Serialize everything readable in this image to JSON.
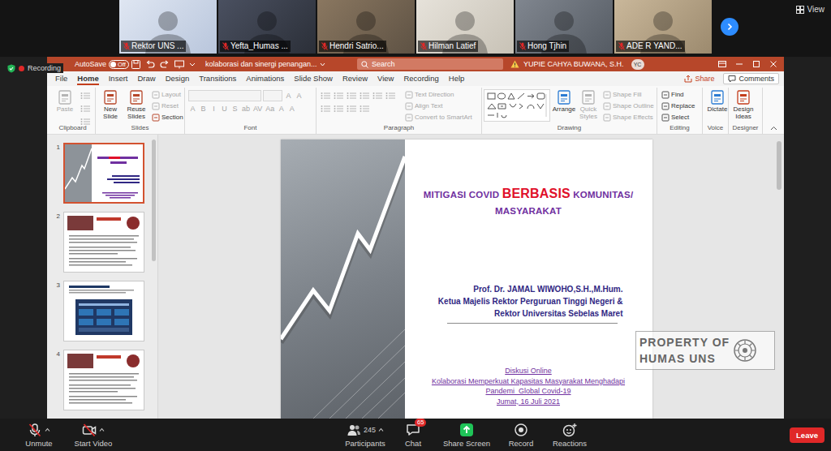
{
  "meeting": {
    "view_button": "View",
    "recording": "Recording",
    "participants": [
      {
        "name": "Rektor UNS ...",
        "muted": true
      },
      {
        "name": "Yefta_Humas ...",
        "muted": true
      },
      {
        "name": "Hendri Satrio...",
        "muted": true
      },
      {
        "name": "Hilman Latief",
        "muted": true
      },
      {
        "name": "Hong Tjhin",
        "muted": true
      },
      {
        "name": "ADE R YAND...",
        "muted": true
      }
    ],
    "toolbar": [
      {
        "label": "Unmute",
        "kind": "mic",
        "slashed": true,
        "has_menu": true
      },
      {
        "label": "Start Video",
        "kind": "video",
        "slashed": true,
        "has_menu": true
      },
      {
        "label": "Participants",
        "kind": "participants",
        "count": "245",
        "slashed": false,
        "has_menu": true
      },
      {
        "label": "Chat",
        "kind": "chat",
        "badge": "65",
        "slashed": false,
        "has_menu": false
      },
      {
        "label": "Share Screen",
        "kind": "share",
        "slashed": false,
        "has_menu": false
      },
      {
        "label": "Record",
        "kind": "record",
        "slashed": false,
        "has_menu": false
      },
      {
        "label": "Reactions",
        "kind": "reactions",
        "slashed": false,
        "has_menu": false
      }
    ],
    "leave": "Leave"
  },
  "app": {
    "title_bar": {
      "autosave_label": "AutoSave",
      "autosave_on": false,
      "autosave_state": "Off",
      "document": "kolaborasi dan sinergi penangan...",
      "search_placeholder": "Search",
      "user": "YUPIE CAHYA BUWANA, S.H.",
      "initials": "YC"
    },
    "menu": [
      {
        "label": "File",
        "selected": false
      },
      {
        "label": "Home",
        "selected": true
      },
      {
        "label": "Insert",
        "selected": false
      },
      {
        "label": "Draw",
        "selected": false
      },
      {
        "label": "Design",
        "selected": false
      },
      {
        "label": "Transitions",
        "selected": false
      },
      {
        "label": "Animations",
        "selected": false
      },
      {
        "label": "Slide Show",
        "selected": false
      },
      {
        "label": "Review",
        "selected": false
      },
      {
        "label": "View",
        "selected": false
      },
      {
        "label": "Recording",
        "selected": false
      },
      {
        "label": "Help",
        "selected": false
      }
    ],
    "share": "Share",
    "comments": "Comments",
    "ribbon": [
      {
        "label": "Clipboard",
        "items": [
          {
            "label": "Paste",
            "kind": "big",
            "disabled": true
          },
          {
            "kind": "icon",
            "disabled": true
          },
          {
            "kind": "icon",
            "disabled": true
          },
          {
            "kind": "icon",
            "disabled": true
          }
        ]
      },
      {
        "label": "Slides",
        "items": [
          {
            "label": "New Slide",
            "kind": "big",
            "disabled": false
          },
          {
            "label": "Reuse Slides",
            "kind": "big",
            "disabled": false
          },
          {
            "label": "Layout",
            "kind": "small",
            "disabled": true
          },
          {
            "label": "Reset",
            "kind": "small",
            "disabled": true
          },
          {
            "label": "Section",
            "kind": "small",
            "disabled": false
          }
        ]
      },
      {
        "label": "Font",
        "items": [
          {
            "kind": "field",
            "disabled": true
          },
          {
            "kind": "field",
            "disabled": true
          },
          {
            "label": "A",
            "kind": "glyph",
            "disabled": true
          },
          {
            "label": "A",
            "kind": "glyph",
            "disabled": true
          },
          {
            "label": "A",
            "kind": "glyph",
            "disabled": true
          },
          {
            "label": "B",
            "kind": "glyph",
            "disabled": true
          },
          {
            "label": "I",
            "kind": "glyph",
            "disabled": true
          },
          {
            "label": "U",
            "kind": "glyph",
            "disabled": true
          },
          {
            "label": "S",
            "kind": "glyph",
            "disabled": true
          },
          {
            "label": "ab",
            "kind": "glyph",
            "disabled": true
          },
          {
            "label": "AV",
            "kind": "glyph",
            "disabled": true
          },
          {
            "label": "Aa",
            "kind": "glyph",
            "disabled": true
          },
          {
            "label": "A",
            "kind": "glyph",
            "disabled": true
          },
          {
            "label": "A",
            "kind": "glyph",
            "disabled": true
          }
        ]
      },
      {
        "label": "Paragraph",
        "items": [
          {
            "kind": "icon",
            "disabled": true
          },
          {
            "kind": "icon",
            "disabled": true
          },
          {
            "kind": "icon",
            "disabled": true
          },
          {
            "kind": "icon",
            "disabled": true
          },
          {
            "kind": "icon",
            "disabled": true
          },
          {
            "kind": "icon",
            "disabled": true
          },
          {
            "kind": "icon",
            "disabled": true
          },
          {
            "kind": "icon",
            "disabled": true
          },
          {
            "kind": "icon",
            "disabled": true
          },
          {
            "kind": "icon",
            "disabled": true
          },
          {
            "label": "Text Direction",
            "kind": "small",
            "disabled": true
          },
          {
            "label": "Align Text",
            "kind": "small",
            "disabled": true
          },
          {
            "label": "Convert to SmartArt",
            "kind": "small",
            "disabled": true
          }
        ]
      },
      {
        "label": "Drawing",
        "items": [
          {
            "kind": "gallery",
            "disabled": false
          },
          {
            "label": "Arrange",
            "kind": "big",
            "disabled": false
          },
          {
            "label": "Quick Styles",
            "kind": "big",
            "disabled": true
          },
          {
            "label": "Shape Fill",
            "kind": "small",
            "disabled": true
          },
          {
            "label": "Shape Outline",
            "kind": "small",
            "disabled": true
          },
          {
            "label": "Shape Effects",
            "kind": "small",
            "disabled": true
          }
        ]
      },
      {
        "label": "Editing",
        "items": [
          {
            "label": "Find",
            "kind": "small",
            "disabled": false
          },
          {
            "label": "Replace",
            "kind": "small",
            "disabled": false
          },
          {
            "label": "Select",
            "kind": "small",
            "disabled": false
          }
        ]
      },
      {
        "label": "Voice",
        "items": [
          {
            "label": "Dictate",
            "kind": "big",
            "disabled": false
          }
        ]
      },
      {
        "label": "Designer",
        "items": [
          {
            "label": "Design Ideas",
            "kind": "big",
            "disabled": false
          }
        ]
      }
    ],
    "slides": [
      {
        "number": "1",
        "selected": true,
        "kind": "title"
      },
      {
        "number": "2",
        "selected": false,
        "kind": "image-text"
      },
      {
        "number": "3",
        "selected": false,
        "kind": "stats"
      },
      {
        "number": "4",
        "selected": false,
        "kind": "image-text"
      }
    ],
    "current_slide": {
      "title_lines": [
        [
          {
            "text": "MITIGASI COVID ",
            "emphasis": false
          },
          {
            "text": "BERBASIS",
            "emphasis": true
          },
          {
            "text": " KOMUNITAS/",
            "emphasis": false
          }
        ],
        [
          {
            "text": "MASYARAKAT",
            "emphasis": false
          }
        ]
      ],
      "author_lines": [
        "Prof. Dr. JAMAL WIWOHO,S.H.,M.Hum.",
        "Ketua Majelis Rektor Perguruan Tinggi Negeri &",
        "Rektor Universitas Sebelas Maret"
      ],
      "event_lines": [
        "Diskusi Online",
        "Kolaborasi Memperkuat Kapasitas Masyarakat Menghadapi",
        "Pandemi  Global Covid-19",
        "Jumat, 16 Juli 2021"
      ]
    }
  },
  "watermark": {
    "lines": [
      "PROPERTY OF",
      "HUMAS UNS"
    ]
  }
}
